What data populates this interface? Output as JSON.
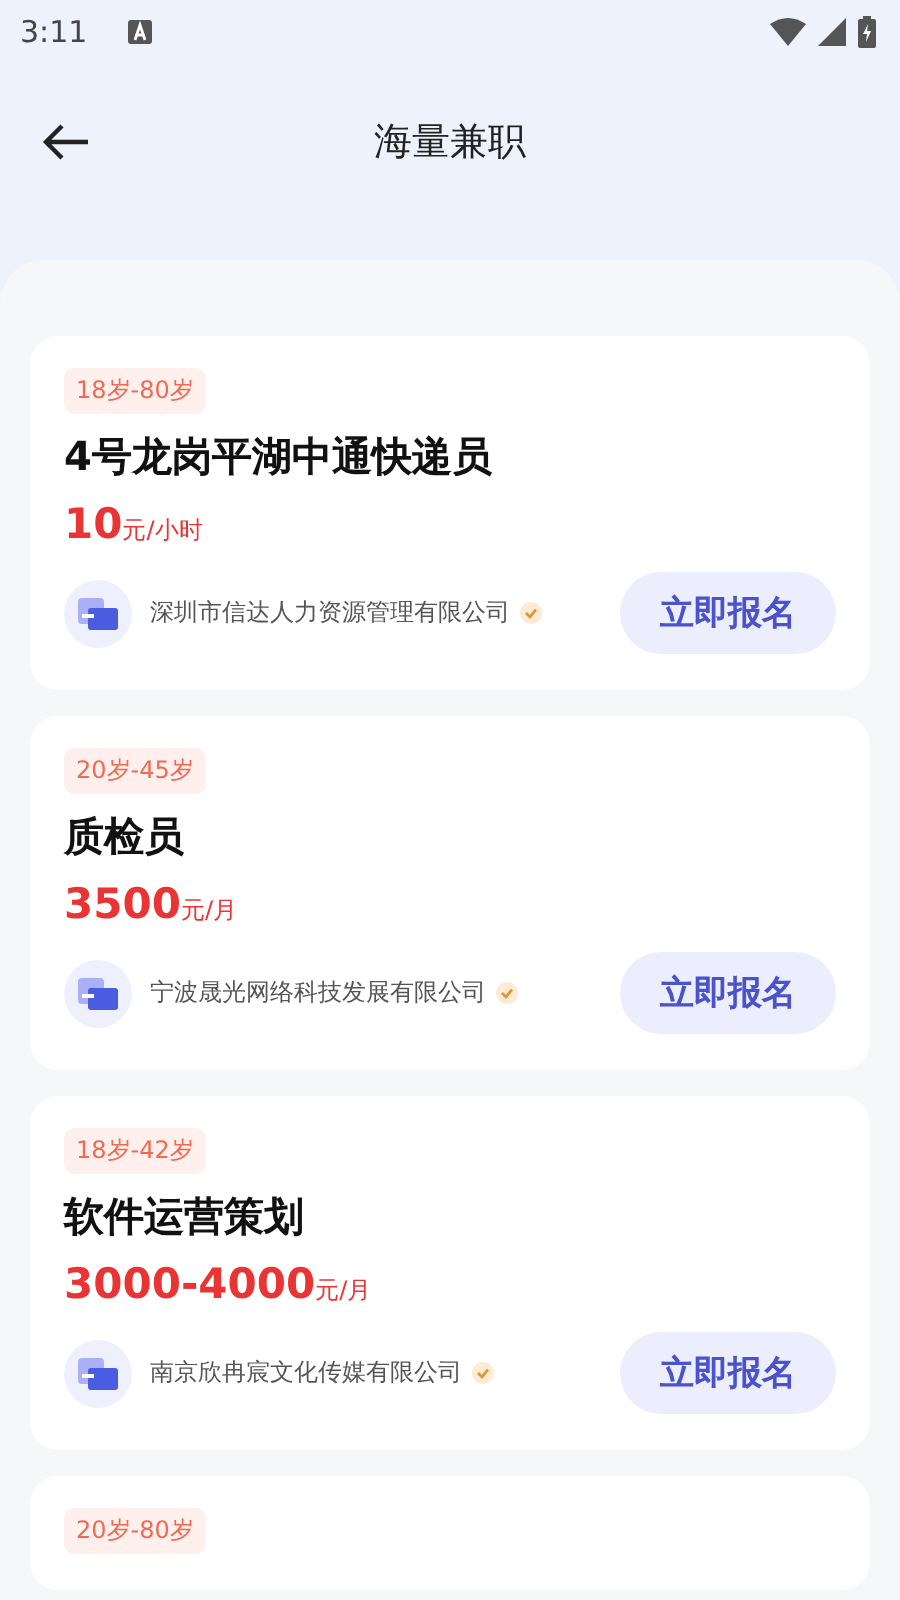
{
  "status_bar": {
    "time": "3:11"
  },
  "header": {
    "title": "海量兼职"
  },
  "jobs": [
    {
      "age": "18岁-80岁",
      "title": "4号龙岗平湖中通快递员",
      "amount": "10",
      "unit": "元/小时",
      "company": "深圳市信达人力资源管理有限公司",
      "verified": true,
      "button": "立即报名"
    },
    {
      "age": "20岁-45岁",
      "title": "质检员",
      "amount": "3500",
      "unit": "元/月",
      "company": "宁波晟光网络科技发展有限公司",
      "verified": true,
      "button": "立即报名"
    },
    {
      "age": "18岁-42岁",
      "title": "软件运营策划",
      "amount": "3000-4000",
      "unit": "元/月",
      "company": "南京欣冉宸文化传媒有限公司",
      "verified": true,
      "button": "立即报名"
    },
    {
      "age": "20岁-80岁"
    }
  ]
}
